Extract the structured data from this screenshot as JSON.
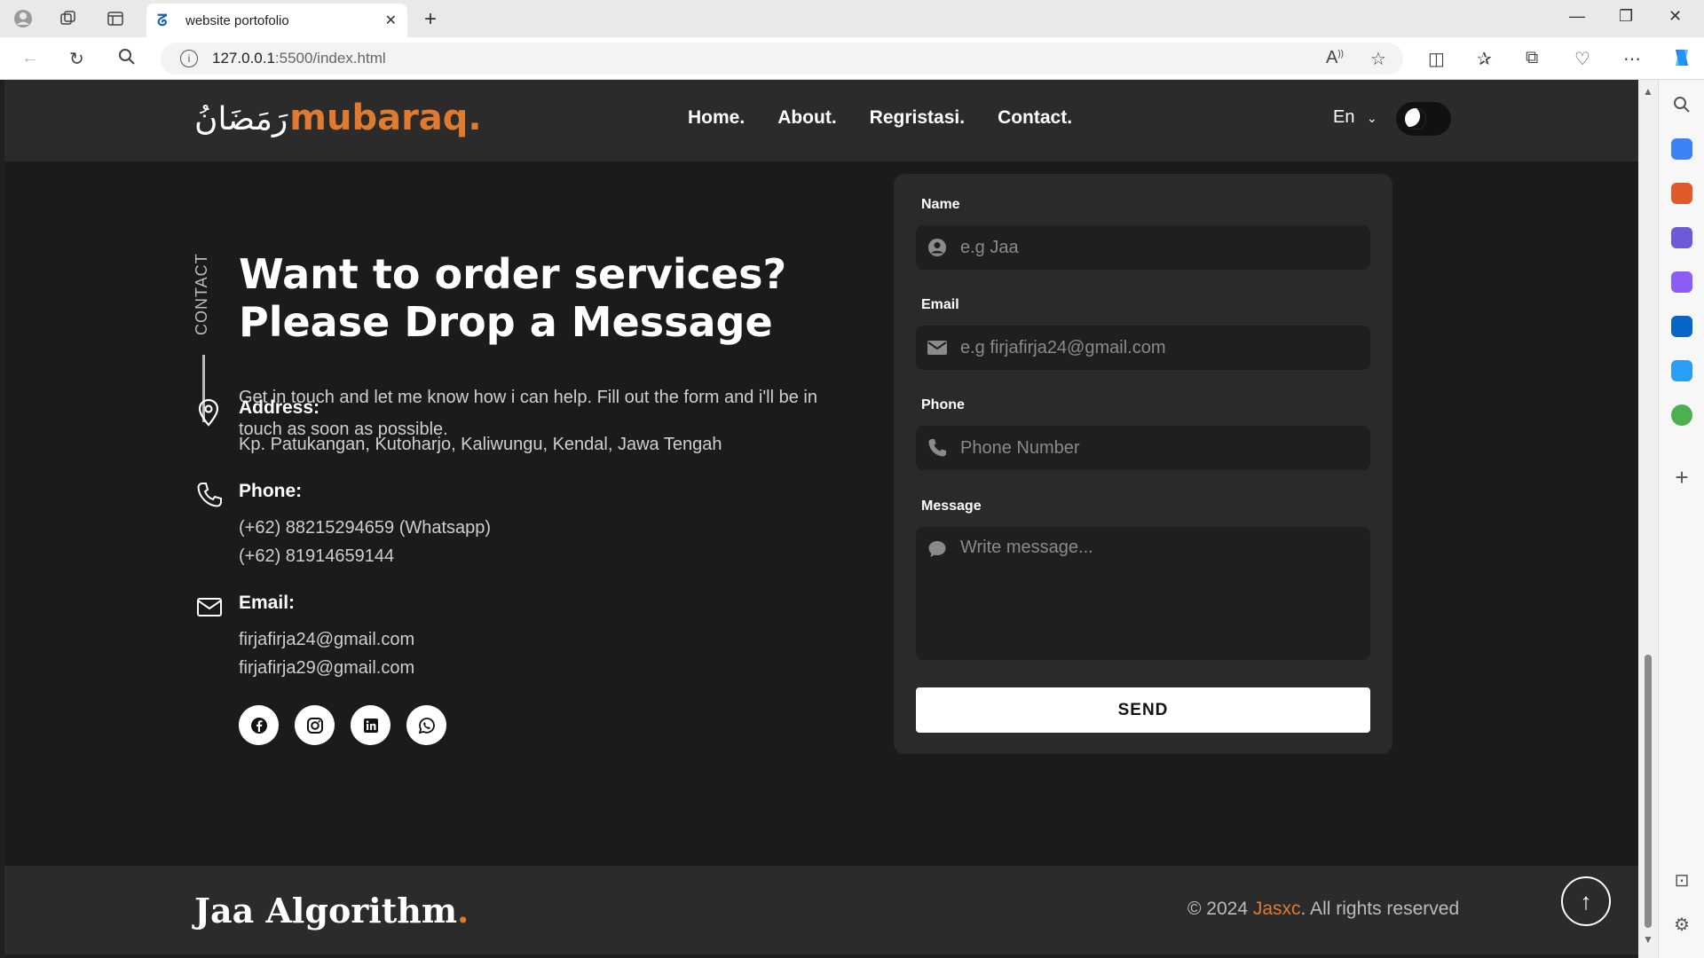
{
  "browser": {
    "tab_title": "website portofolio",
    "url_host": "127.0.0.1",
    "url_path": ":5500/index.html"
  },
  "header": {
    "logo_arabic": "رَمَضَانُ",
    "logo_text": "mubaraq.",
    "menu": [
      "Home.",
      "About.",
      "Regristasi.",
      "Contact."
    ],
    "lang": "En"
  },
  "contact": {
    "section_label": "CONTACT",
    "heading_line1": "Want to order services?",
    "heading_line2": "Please Drop a Message",
    "intro": "Get in touch and let me know how i can help. Fill out the form and i'll be in touch as soon as possible.",
    "address_label": "Address:",
    "address_value": "Kp. Patukangan, Kutoharjo, Kaliwungu, Kendal, Jawa Tengah",
    "phone_label": "Phone:",
    "phone_1": "(+62) 88215294659 (Whatsapp)",
    "phone_2": "(+62) 81914659144",
    "email_label": "Email:",
    "email_1": "firjafirja24@gmail.com",
    "email_2": "firjafirja29@gmail.com"
  },
  "form": {
    "name_label": "Name",
    "name_placeholder": "e.g Jaa",
    "email_label": "Email",
    "email_placeholder": "e.g firjafirja24@gmail.com",
    "phone_label": "Phone",
    "phone_placeholder": "Phone Number",
    "message_label": "Message",
    "message_placeholder": "Write message...",
    "send_label": "SEND"
  },
  "footer": {
    "logo_text": "Jaa Algorithm",
    "logo_dot": ".",
    "copyright_prefix": "© 2024 ",
    "copyright_brand": "Jasxc",
    "copyright_suffix": ". All rights reserved"
  },
  "colors": {
    "accent": "#e07a2e",
    "background": "#1b1b1b",
    "card": "#2a2a2a"
  }
}
